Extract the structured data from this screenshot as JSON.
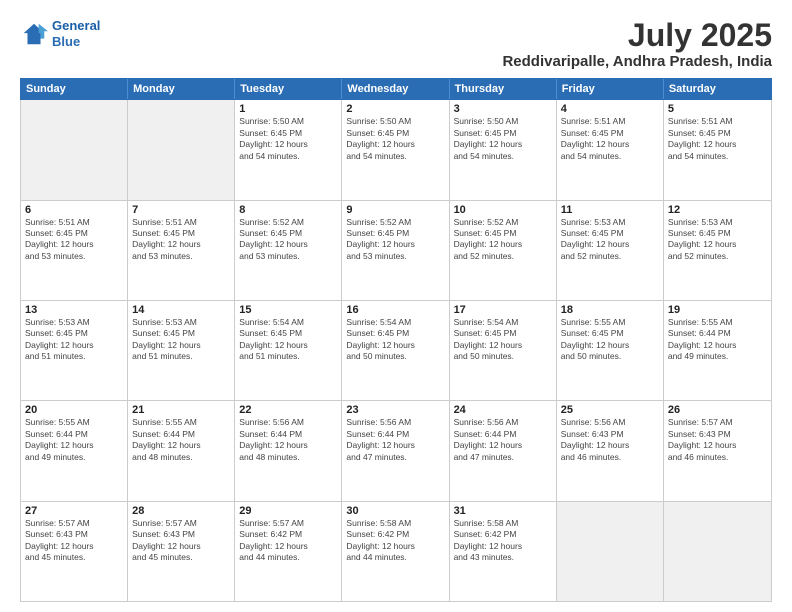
{
  "header": {
    "logo_line1": "General",
    "logo_line2": "Blue",
    "month": "July 2025",
    "location": "Reddivaripalle, Andhra Pradesh, India"
  },
  "days_of_week": [
    "Sunday",
    "Monday",
    "Tuesday",
    "Wednesday",
    "Thursday",
    "Friday",
    "Saturday"
  ],
  "weeks": [
    [
      {
        "day": "",
        "info": ""
      },
      {
        "day": "",
        "info": ""
      },
      {
        "day": "1",
        "info": "Sunrise: 5:50 AM\nSunset: 6:45 PM\nDaylight: 12 hours\nand 54 minutes."
      },
      {
        "day": "2",
        "info": "Sunrise: 5:50 AM\nSunset: 6:45 PM\nDaylight: 12 hours\nand 54 minutes."
      },
      {
        "day": "3",
        "info": "Sunrise: 5:50 AM\nSunset: 6:45 PM\nDaylight: 12 hours\nand 54 minutes."
      },
      {
        "day": "4",
        "info": "Sunrise: 5:51 AM\nSunset: 6:45 PM\nDaylight: 12 hours\nand 54 minutes."
      },
      {
        "day": "5",
        "info": "Sunrise: 5:51 AM\nSunset: 6:45 PM\nDaylight: 12 hours\nand 54 minutes."
      }
    ],
    [
      {
        "day": "6",
        "info": "Sunrise: 5:51 AM\nSunset: 6:45 PM\nDaylight: 12 hours\nand 53 minutes."
      },
      {
        "day": "7",
        "info": "Sunrise: 5:51 AM\nSunset: 6:45 PM\nDaylight: 12 hours\nand 53 minutes."
      },
      {
        "day": "8",
        "info": "Sunrise: 5:52 AM\nSunset: 6:45 PM\nDaylight: 12 hours\nand 53 minutes."
      },
      {
        "day": "9",
        "info": "Sunrise: 5:52 AM\nSunset: 6:45 PM\nDaylight: 12 hours\nand 53 minutes."
      },
      {
        "day": "10",
        "info": "Sunrise: 5:52 AM\nSunset: 6:45 PM\nDaylight: 12 hours\nand 52 minutes."
      },
      {
        "day": "11",
        "info": "Sunrise: 5:53 AM\nSunset: 6:45 PM\nDaylight: 12 hours\nand 52 minutes."
      },
      {
        "day": "12",
        "info": "Sunrise: 5:53 AM\nSunset: 6:45 PM\nDaylight: 12 hours\nand 52 minutes."
      }
    ],
    [
      {
        "day": "13",
        "info": "Sunrise: 5:53 AM\nSunset: 6:45 PM\nDaylight: 12 hours\nand 51 minutes."
      },
      {
        "day": "14",
        "info": "Sunrise: 5:53 AM\nSunset: 6:45 PM\nDaylight: 12 hours\nand 51 minutes."
      },
      {
        "day": "15",
        "info": "Sunrise: 5:54 AM\nSunset: 6:45 PM\nDaylight: 12 hours\nand 51 minutes."
      },
      {
        "day": "16",
        "info": "Sunrise: 5:54 AM\nSunset: 6:45 PM\nDaylight: 12 hours\nand 50 minutes."
      },
      {
        "day": "17",
        "info": "Sunrise: 5:54 AM\nSunset: 6:45 PM\nDaylight: 12 hours\nand 50 minutes."
      },
      {
        "day": "18",
        "info": "Sunrise: 5:55 AM\nSunset: 6:45 PM\nDaylight: 12 hours\nand 50 minutes."
      },
      {
        "day": "19",
        "info": "Sunrise: 5:55 AM\nSunset: 6:44 PM\nDaylight: 12 hours\nand 49 minutes."
      }
    ],
    [
      {
        "day": "20",
        "info": "Sunrise: 5:55 AM\nSunset: 6:44 PM\nDaylight: 12 hours\nand 49 minutes."
      },
      {
        "day": "21",
        "info": "Sunrise: 5:55 AM\nSunset: 6:44 PM\nDaylight: 12 hours\nand 48 minutes."
      },
      {
        "day": "22",
        "info": "Sunrise: 5:56 AM\nSunset: 6:44 PM\nDaylight: 12 hours\nand 48 minutes."
      },
      {
        "day": "23",
        "info": "Sunrise: 5:56 AM\nSunset: 6:44 PM\nDaylight: 12 hours\nand 47 minutes."
      },
      {
        "day": "24",
        "info": "Sunrise: 5:56 AM\nSunset: 6:44 PM\nDaylight: 12 hours\nand 47 minutes."
      },
      {
        "day": "25",
        "info": "Sunrise: 5:56 AM\nSunset: 6:43 PM\nDaylight: 12 hours\nand 46 minutes."
      },
      {
        "day": "26",
        "info": "Sunrise: 5:57 AM\nSunset: 6:43 PM\nDaylight: 12 hours\nand 46 minutes."
      }
    ],
    [
      {
        "day": "27",
        "info": "Sunrise: 5:57 AM\nSunset: 6:43 PM\nDaylight: 12 hours\nand 45 minutes."
      },
      {
        "day": "28",
        "info": "Sunrise: 5:57 AM\nSunset: 6:43 PM\nDaylight: 12 hours\nand 45 minutes."
      },
      {
        "day": "29",
        "info": "Sunrise: 5:57 AM\nSunset: 6:42 PM\nDaylight: 12 hours\nand 44 minutes."
      },
      {
        "day": "30",
        "info": "Sunrise: 5:58 AM\nSunset: 6:42 PM\nDaylight: 12 hours\nand 44 minutes."
      },
      {
        "day": "31",
        "info": "Sunrise: 5:58 AM\nSunset: 6:42 PM\nDaylight: 12 hours\nand 43 minutes."
      },
      {
        "day": "",
        "info": ""
      },
      {
        "day": "",
        "info": ""
      }
    ]
  ]
}
